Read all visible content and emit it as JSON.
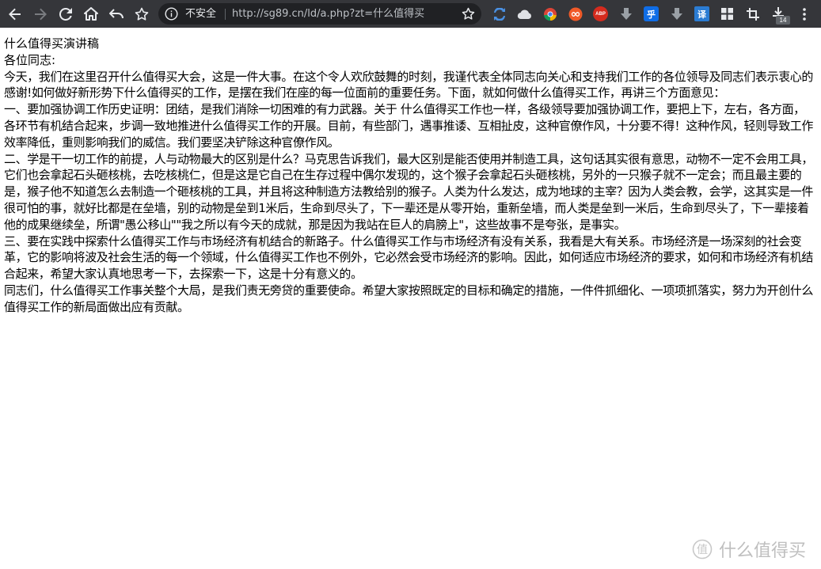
{
  "browser": {
    "security_label": "不安全",
    "url": "http://sg89.cn/ld/a.php?zt=什么值得买",
    "download_count": "14",
    "ext_abp_label": "ABP",
    "ext_zhihu_label": "乎",
    "ext_translate_label": "译"
  },
  "document": {
    "title": "什么值得买演讲稿",
    "greeting": "各位同志:",
    "paragraphs": [
      "今天，我们在这里召开什么值得买大会，这是一件大事。在这个令人欢欣鼓舞的时刻，我谨代表全体同志向关心和支持我们工作的各位领导及同志们表示衷心的感谢!如何做好新形势下什么值得买的工作，是摆在我们在座的每一位面前的重要任务。下面，就如何做什么值得买工作，再讲三个方面意见：",
      "一、要加强协调工作历史证明：团结，是我们消除一切困难的有力武器。关于 什么值得买工作也一样，各级领导要加强协调工作，要把上下，左右，各方面，各环节有机结合起来，步调一致地推进什么值得买工作的开展。目前，有些部门，遇事推诿、互相扯皮，这种官僚作风，十分要不得！这种作风，轻则导致工作效率降低，重则影响我们的威信。我们要坚决铲除这种官僚作风。",
      "二、学是干一切工作的前提，人与动物最大的区别是什么？马克思告诉我们，最大区别是能否使用并制造工具，这句话其实很有意思，动物不一定不会用工具，它们也会拿起石头砸核桃，去吃核桃仁，但是这是它自己在生存过程中偶尔发现的，这个猴子会拿起石头砸核桃，另外的一只猴子就不一定会；而且最主要的是，猴子他不知道怎么去制造一个砸核桃的工具，并且将这种制造方法教给别的猴子。人类为什么发达，成为地球的主宰？因为人类会教，会学，这其实是一件很可怕的事，就好比都是在垒墙，别的动物是垒到1米后，生命到尽头了，下一辈还是从零开始，重新垒墙，而人类是垒到一米后，生命到尽头了，下一辈接着他的成果继续垒，所谓\"愚公移山\"\"我之所以有今天的成就，那是因为我站在巨人的肩膀上\"，这些故事不是夸张，是事实。",
      "三、要在实践中探索什么值得买工作与市场经济有机结合的新路子。什么值得买工作与市场经济有没有关系，我看是大有关系。市场经济是一场深刻的社会变革，它的影响将波及社会生活的每一个领域，什么值得买工作也不例外，它必然会受市场经济的影响。因此，如何适应市场经济的要求，如何和市场经济有机结合起来，希望大家认真地思考一下，去探索一下，这是十分有意义的。",
      "同志们，什么值得买工作事关整个大局，是我们责无旁贷的重要使命。希望大家按照既定的目标和确定的措施，一件件抓细化、一项项抓落实，努力为开创什么值得买工作的新局面做出应有贡献。"
    ]
  },
  "watermark": {
    "text": "什么值得买"
  }
}
